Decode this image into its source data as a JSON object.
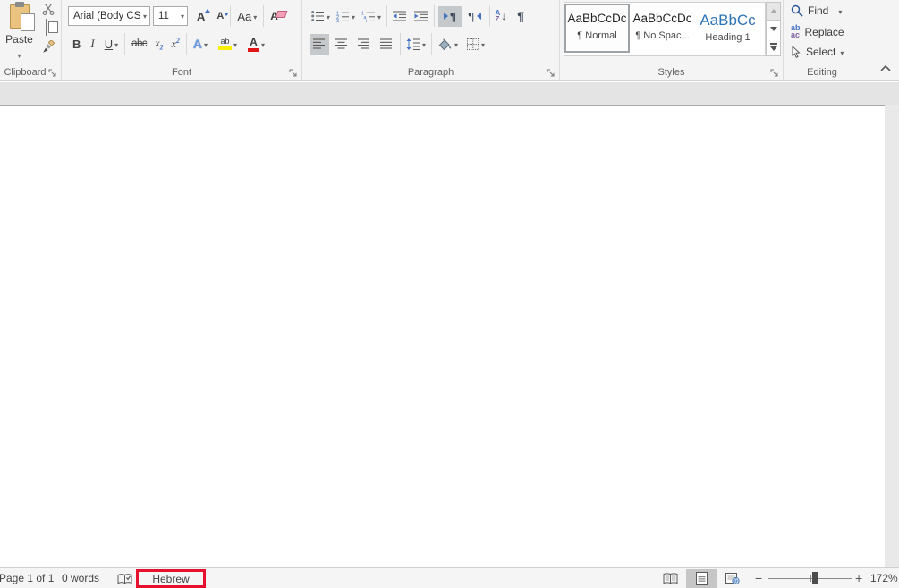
{
  "ribbon": {
    "clipboard": {
      "label": "Clipboard",
      "paste_label": "Paste"
    },
    "font": {
      "label": "Font",
      "family_value": "Arial (Body CS",
      "size_value": "11",
      "grow_font": "A",
      "shrink_font": "A",
      "change_case": "Aa",
      "clear_formatting": "A",
      "bold": "B",
      "italic": "I",
      "underline": "U",
      "strikethrough": "abc",
      "sub_base": "x",
      "sub_mark": "2",
      "sup_base": "x",
      "sup_mark": "2",
      "text_effects": "A",
      "highlight_ab": "ab",
      "font_color_a": "A"
    },
    "paragraph": {
      "label": "Paragraph",
      "ltr_mark": "¶",
      "rtl_mark": "¶",
      "sort_a": "A",
      "sort_z": "Z",
      "sort_arrow": "↓",
      "show_hide": "¶"
    },
    "styles": {
      "label": "Styles",
      "items": [
        {
          "preview": "AaBbCcDc",
          "name": "¶ Normal"
        },
        {
          "preview": "AaBbCcDc",
          "name": "¶ No Spac..."
        },
        {
          "preview": "AaBbCc",
          "name": "Heading 1"
        }
      ]
    },
    "editing": {
      "label": "Editing",
      "find": "Find",
      "replace": "Replace",
      "replace_ab": "ab",
      "replace_ac": "ac",
      "select": "Select"
    }
  },
  "status_bar": {
    "page_indicator": "Page 1 of 1",
    "word_count": "0 words",
    "language": "Hebrew",
    "zoom_out": "−",
    "zoom_in": "+",
    "zoom_percent": "172%"
  },
  "annotation": {
    "target": "language-button",
    "color": "#e8112d"
  },
  "colors": {
    "heading_blue": "#2E74B5",
    "selected_gray": "#c6c9cb",
    "highlight_yellow": "#f7f000",
    "font_color_red": "#e01515",
    "annotation_red": "#e8112d"
  }
}
